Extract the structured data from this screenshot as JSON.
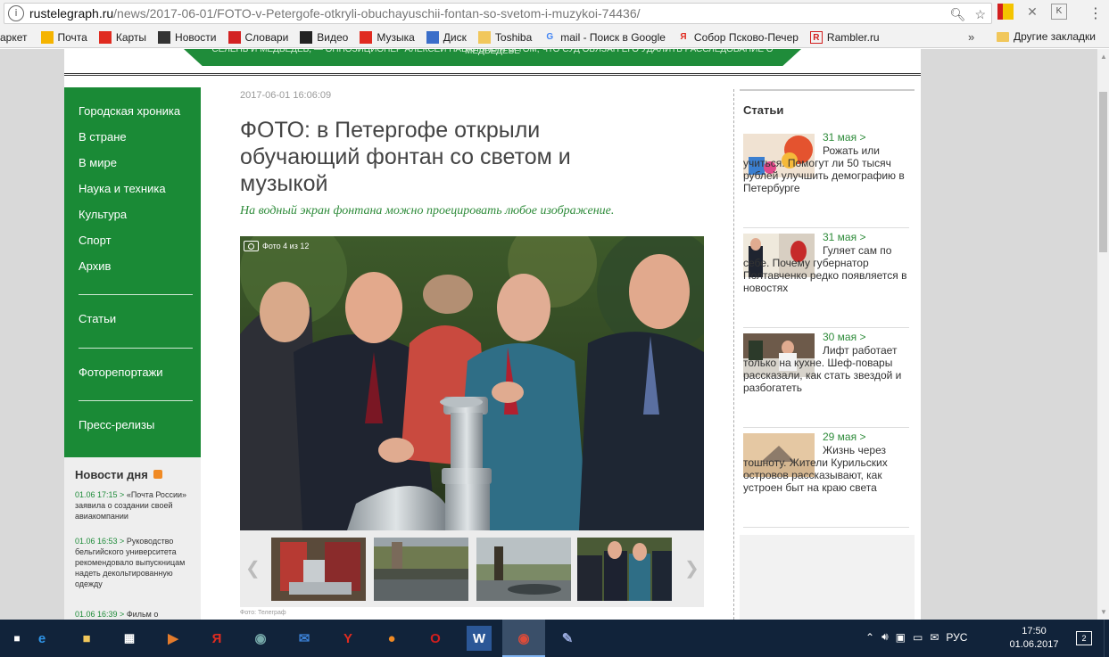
{
  "browser": {
    "url_host": "rustelegraph.ru",
    "url_path": "/news/2017-06-01/FOTO-v-Petergofe-otkryli-obuchayuschii-fontan-so-svetom-i-muzykoi-74436/",
    "bookmarks": [
      {
        "label": "аркет",
        "icon": "market-icon",
        "color": "#f5f5f5"
      },
      {
        "label": "Почта",
        "icon": "mail-icon",
        "color": "#f5b400"
      },
      {
        "label": "Карты",
        "icon": "map-pin-icon",
        "color": "#e02b20"
      },
      {
        "label": "Новости",
        "icon": "news-icon",
        "color": "#333333"
      },
      {
        "label": "Словари",
        "icon": "dictionary-icon",
        "color": "#d32222"
      },
      {
        "label": "Видео",
        "icon": "video-icon",
        "color": "#222222"
      },
      {
        "label": "Музыка",
        "icon": "music-icon",
        "color": "#e02b20"
      },
      {
        "label": "Диск",
        "icon": "disk-icon",
        "color": "#3a6ec9"
      },
      {
        "label": "Toshiba",
        "icon": "folder-icon",
        "color": "#f1c75b"
      },
      {
        "label": "mail - Поиск в Google",
        "icon": "google-icon",
        "color": "#4285f4"
      },
      {
        "label": "Собор Псково-Печер",
        "icon": "yandex-icon",
        "color": "#ffffff"
      },
      {
        "label": "Rambler.ru",
        "icon": "rambler-icon",
        "color": "#ffffff"
      }
    ],
    "more_label": "»",
    "other_bookmarks": "Другие закладки"
  },
  "banner_text": "СЕЛЕНЬ И МЕДВЕДЕВ, — ОППОЗИЦИОНЕР АЛЕКСЕЙ НАВАЛЬНЫЙ О ТОМ, ЧТО СУД ОБЯЗАН ЕГО УДАЛИТЬ РАССЛЕДОВАНИЕ О МЕДВЕДЕВЕ",
  "nav": {
    "items": [
      "Городская хроника",
      "В стране",
      "В мире",
      "Наука и техника",
      "Культура",
      "Спорт",
      "Архив"
    ],
    "sections": [
      "Статьи",
      "Фоторепортажи",
      "Пресс-релизы"
    ]
  },
  "news": {
    "title": "Новости дня",
    "items": [
      {
        "time": "01.06 17:15 >",
        "text": "«Почта России» заявила о создании своей авиакомпании"
      },
      {
        "time": "01.06 16:53 >",
        "text": "Руководство бельгийского университета рекомендовало выпускницам надеть декольтированную одежду"
      },
      {
        "time": "01.06 16:39 >",
        "text": "Фильм о"
      }
    ]
  },
  "article": {
    "date": "2017-06-01 16:06:09",
    "title": "ФОТО: в Петергофе открыли обучающий фонтан со светом и музыкой",
    "subtitle": "На водный экран фонтана можно проецировать любое изображение.",
    "photo_counter": "Фото 4 из 12",
    "credit": "Фото: Телеграф"
  },
  "aside": {
    "title": "Статьи",
    "articles": [
      {
        "date": "31 мая >",
        "text": "Рожать или учиться. Помогут ли 50 тысяч рублей улучшить демографию в Петербурге"
      },
      {
        "date": "31 мая >",
        "text": "Гуляет сам по себе. Почему губернатор Полтавченко редко появляется в новостях"
      },
      {
        "date": "30 мая >",
        "text": "Лифт работает только на кухне. Шеф-повары рассказали, как стать звездой и разбогатеть"
      },
      {
        "date": "29 мая >",
        "text": "Жизнь через тошноту. Жители Курильских островов рассказывают, как устроен быт на краю света"
      }
    ]
  },
  "taskbar": {
    "language": "РУС",
    "time": "17:50",
    "date": "01.06.2017",
    "notifications": "2"
  }
}
